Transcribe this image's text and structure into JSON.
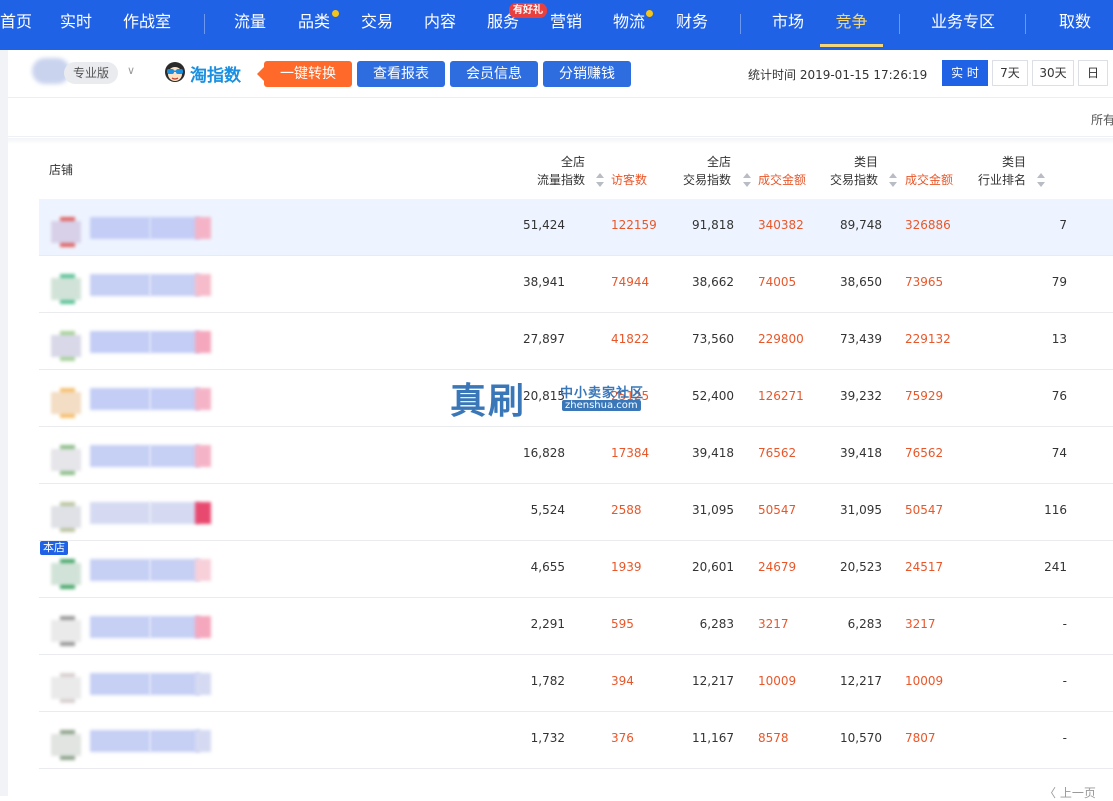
{
  "nav": {
    "items": [
      "首页",
      "实时",
      "作战室",
      "流量",
      "品类",
      "交易",
      "内容",
      "服务",
      "营销",
      "物流",
      "财务",
      "市场",
      "竞争",
      "业务专区",
      "取数"
    ],
    "active": "竞争",
    "service_badge": "有好礼"
  },
  "subbar": {
    "edition_label": "专业版",
    "logo_text": "淘指数",
    "convert_btn": "一键转换",
    "report_btn": "查看报表",
    "member_btn": "会员信息",
    "distribute_btn": "分销赚钱",
    "stat_time_label": "统计时间 2019-01-15 17:26:19",
    "ranges": [
      "实 时",
      "7天",
      "30天",
      "日"
    ],
    "active_range": "实 时",
    "all_link": "所有"
  },
  "table": {
    "headers": {
      "shop": "店铺",
      "traffic_top": "全店",
      "traffic_bottom": "流量指数",
      "visitors": "访客数",
      "trade_top": "全店",
      "trade_bottom": "交易指数",
      "amount": "成交金额",
      "cat_trade_top": "类目",
      "cat_trade_bottom": "交易指数",
      "cat_amount": "成交金额",
      "rank_top": "类目",
      "rank_bottom": "行业排名"
    },
    "self_tag": "本店",
    "rows": [
      {
        "traffic": "51,424",
        "visitors": "122159",
        "trade": "91,818",
        "amount": "340382",
        "cat_trade": "89,748",
        "cat_amount": "326886",
        "rank": "7"
      },
      {
        "traffic": "38,941",
        "visitors": "74944",
        "trade": "38,662",
        "amount": "74005",
        "cat_trade": "38,650",
        "cat_amount": "73965",
        "rank": "79"
      },
      {
        "traffic": "27,897",
        "visitors": "41822",
        "trade": "73,560",
        "amount": "229800",
        "cat_trade": "73,439",
        "cat_amount": "229132",
        "rank": "13"
      },
      {
        "traffic": "20,815",
        "visitors": "25125",
        "trade": "52,400",
        "amount": "126271",
        "cat_trade": "39,232",
        "cat_amount": "75929",
        "rank": "76"
      },
      {
        "traffic": "16,828",
        "visitors": "17384",
        "trade": "39,418",
        "amount": "76562",
        "cat_trade": "39,418",
        "cat_amount": "76562",
        "rank": "74"
      },
      {
        "traffic": "5,524",
        "visitors": "2588",
        "trade": "31,095",
        "amount": "50547",
        "cat_trade": "31,095",
        "cat_amount": "50547",
        "rank": "116"
      },
      {
        "traffic": "4,655",
        "visitors": "1939",
        "trade": "20,601",
        "amount": "24679",
        "cat_trade": "20,523",
        "cat_amount": "24517",
        "rank": "241"
      },
      {
        "traffic": "2,291",
        "visitors": "595",
        "trade": "6,283",
        "amount": "3217",
        "cat_trade": "6,283",
        "cat_amount": "3217",
        "rank": "-"
      },
      {
        "traffic": "1,782",
        "visitors": "394",
        "trade": "12,217",
        "amount": "10009",
        "cat_trade": "12,217",
        "cat_amount": "10009",
        "rank": "-"
      },
      {
        "traffic": "1,732",
        "visitors": "376",
        "trade": "11,167",
        "amount": "8578",
        "cat_trade": "10,570",
        "cat_amount": "7807",
        "rank": "-"
      }
    ]
  },
  "watermark": {
    "big": "真刷",
    "small": "中小卖家社区",
    "url": "zhenshua.com"
  },
  "pagination": {
    "prev": "〈 上一页"
  },
  "colors": {
    "nav_bg": "#2062e6",
    "nav_active": "#f3d67a",
    "accent_red": "#e8572a",
    "button_blue": "#2e6de0",
    "button_orange": "#ff6a2a",
    "highlight_row": "#eef4ff"
  }
}
